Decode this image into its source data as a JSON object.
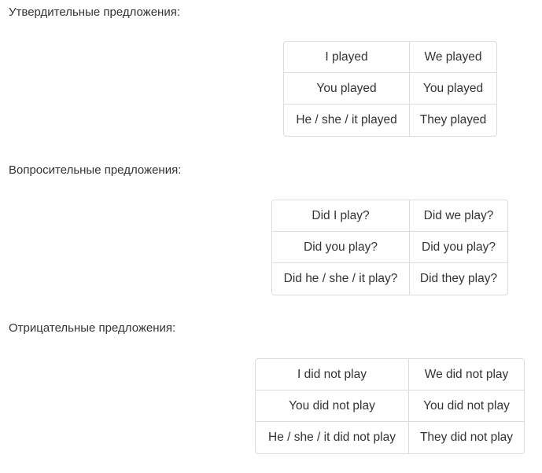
{
  "sections": [
    {
      "heading": "Утвердительные предложения:",
      "rows": [
        [
          "I played",
          "We played"
        ],
        [
          "You played",
          "You played"
        ],
        [
          "He / she / it played",
          "They played"
        ]
      ]
    },
    {
      "heading": "Вопросительные предложения:",
      "rows": [
        [
          "Did I play?",
          "Did we play?"
        ],
        [
          "Did you play?",
          "Did you play?"
        ],
        [
          "Did he / she / it play?",
          "Did they play?"
        ]
      ]
    },
    {
      "heading": "Отрицательные предложения:",
      "rows": [
        [
          "I did not play",
          "We did not play"
        ],
        [
          "You did not play",
          "You did not play"
        ],
        [
          "He / she / it did not play",
          "They did not play"
        ]
      ]
    }
  ],
  "colors": {
    "text": "#333333",
    "border": "#dcdcdc",
    "background": "#ffffff"
  }
}
